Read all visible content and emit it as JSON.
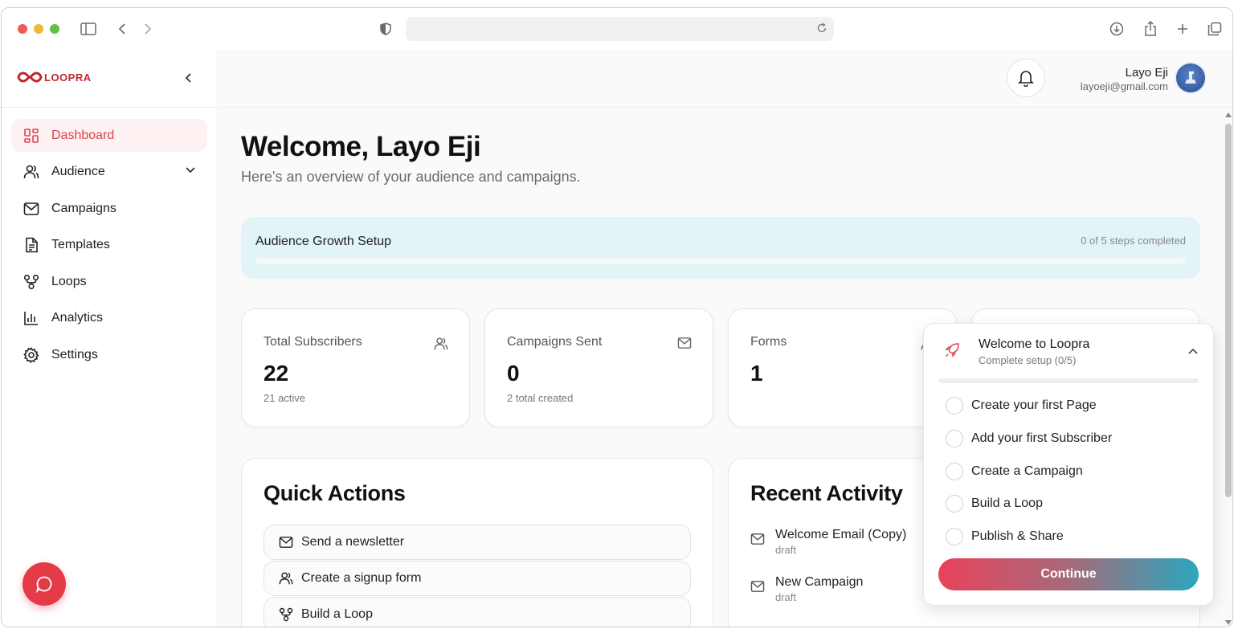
{
  "brand": {
    "name": "LOOPRA",
    "accent": "#e53a47",
    "teal": "#2ea7b8"
  },
  "sidebar": {
    "items": [
      {
        "label": "Dashboard",
        "icon": "dashboard-icon",
        "active": true
      },
      {
        "label": "Audience",
        "icon": "users-icon",
        "has_submenu": true
      },
      {
        "label": "Campaigns",
        "icon": "mail-icon"
      },
      {
        "label": "Templates",
        "icon": "document-icon"
      },
      {
        "label": "Loops",
        "icon": "loop-icon"
      },
      {
        "label": "Analytics",
        "icon": "bar-chart-icon"
      },
      {
        "label": "Settings",
        "icon": "gear-icon"
      }
    ]
  },
  "user": {
    "name": "Layo Eji",
    "email": "layoeji@gmail.com"
  },
  "header": {
    "title": "Welcome, Layo Eji",
    "subtitle": "Here's an overview of your audience and campaigns."
  },
  "setup": {
    "title": "Audience Growth Setup",
    "steps_text": "0 of 5 steps completed",
    "progress_percent": 0
  },
  "stats": [
    {
      "label": "Total Subscribers",
      "value": "22",
      "sub": "21 active",
      "icon": "users-icon"
    },
    {
      "label": "Campaigns Sent",
      "value": "0",
      "sub": "2 total created",
      "icon": "mail-icon"
    },
    {
      "label": "Forms",
      "value": "1",
      "sub": "",
      "icon": "users-icon"
    }
  ],
  "quick_actions": {
    "title": "Quick Actions",
    "items": [
      {
        "label": "Send a newsletter",
        "icon": "mail-icon"
      },
      {
        "label": "Create a signup form",
        "icon": "users-icon"
      },
      {
        "label": "Build a Loop",
        "icon": "loop-icon"
      }
    ]
  },
  "recent_activity": {
    "title": "Recent Activity",
    "items": [
      {
        "title": "Welcome Email (Copy)",
        "status": "draft"
      },
      {
        "title": "New Campaign",
        "status": "draft"
      }
    ]
  },
  "onboarding": {
    "title": "Welcome to Loopra",
    "subtitle": "Complete setup (0/5)",
    "progress_percent": 0,
    "steps": [
      "Create your first Page",
      "Add your first Subscriber",
      "Create a Campaign",
      "Build a Loop",
      "Publish & Share"
    ],
    "continue_label": "Continue"
  }
}
